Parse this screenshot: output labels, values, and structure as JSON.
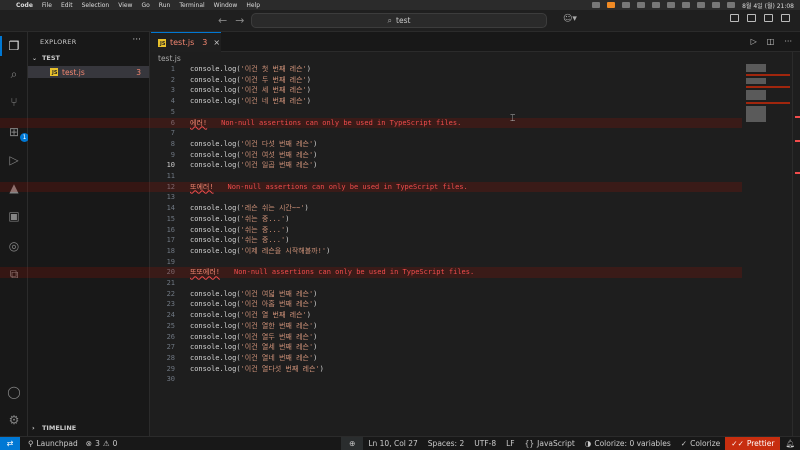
{
  "menubar": {
    "apple": "",
    "items": [
      "Code",
      "File",
      "Edit",
      "Selection",
      "View",
      "Go",
      "Run",
      "Terminal",
      "Window",
      "Help"
    ],
    "clock": "8월 4일 (월) 21:08"
  },
  "titlebar": {
    "search_text": "test"
  },
  "activity": {
    "extensions_badge": "1"
  },
  "sidebar": {
    "header": "EXPLORER",
    "folder": "TEST",
    "file": {
      "name": "test.js",
      "problems": "3"
    },
    "timeline": "TIMELINE"
  },
  "editor": {
    "tab": {
      "name": "test.js",
      "problems": "3"
    },
    "breadcrumb": "test.js",
    "lines": [
      {
        "n": "1",
        "obj": "console.log(",
        "str": "'이건 첫 번째 레슨'",
        "end": ")"
      },
      {
        "n": "2",
        "obj": "console.log(",
        "str": "'이건 두 번째 레슨'",
        "end": ")"
      },
      {
        "n": "3",
        "obj": "console.log(",
        "str": "'이건 세 번째 레슨'",
        "end": ")"
      },
      {
        "n": "4",
        "obj": "console.log(",
        "str": "'이건 네 번째 레슨'",
        "end": ")"
      },
      {
        "n": "5"
      },
      {
        "n": "6",
        "label": "에러!",
        "msg": "Non-null assertions can only be used in TypeScript files."
      },
      {
        "n": "7"
      },
      {
        "n": "8",
        "obj": "console.log(",
        "str": "'이건 다섯 번째 레슨'",
        "end": ")"
      },
      {
        "n": "9",
        "obj": "console.log(",
        "str": "'이건 여섯 번째 레슨'",
        "end": ")"
      },
      {
        "n": "10",
        "obj": "console.log(",
        "str": "'이건 일곱 번째 레슨'",
        "end": ")"
      },
      {
        "n": "11"
      },
      {
        "n": "12",
        "label": "또에러!",
        "msg": "Non-null assertions can only be used in TypeScript files."
      },
      {
        "n": "13"
      },
      {
        "n": "14",
        "obj": "console.log(",
        "str": "'레슨 쉬는 시간~~'",
        "end": ")"
      },
      {
        "n": "15",
        "obj": "console.log(",
        "str": "'쉬는 중...'",
        "end": ")"
      },
      {
        "n": "16",
        "obj": "console.log(",
        "str": "'쉬는 중...'",
        "end": ")"
      },
      {
        "n": "17",
        "obj": "console.log(",
        "str": "'쉬는 중...'",
        "end": ")"
      },
      {
        "n": "18",
        "obj": "console.log(",
        "str": "'이제 레슨을 시작해볼까!'",
        "end": ")"
      },
      {
        "n": "19"
      },
      {
        "n": "20",
        "label": "또또에러!",
        "msg": "Non-null assertions can only be used in TypeScript files."
      },
      {
        "n": "21"
      },
      {
        "n": "22",
        "obj": "console.log(",
        "str": "'이건 여덟 번째 레슨'",
        "end": ")"
      },
      {
        "n": "23",
        "obj": "console.log(",
        "str": "'이건 아홉 번째 레슨'",
        "end": ")"
      },
      {
        "n": "24",
        "obj": "console.log(",
        "str": "'이건 열 번째 레슨'",
        "end": ")"
      },
      {
        "n": "25",
        "obj": "console.log(",
        "str": "'이건 열한 번째 레슨'",
        "end": ")"
      },
      {
        "n": "26",
        "obj": "console.log(",
        "str": "'이건 열두 번째 레슨'",
        "end": ")"
      },
      {
        "n": "27",
        "obj": "console.log(",
        "str": "'이건 열세 번째 레슨'",
        "end": ")"
      },
      {
        "n": "28",
        "obj": "console.log(",
        "str": "'이건 열네 번째 레슨'",
        "end": ")"
      },
      {
        "n": "29",
        "obj": "console.log(",
        "str": "'이건 열다섯 번째 레슨'",
        "end": ")"
      },
      {
        "n": "30"
      }
    ],
    "current_line": "10"
  },
  "statusbar": {
    "launchpad": "Launchpad",
    "errors": "3",
    "warnings": "0",
    "position": "Ln 10, Col 27",
    "spaces": "Spaces: 2",
    "encoding": "UTF-8",
    "eol": "LF",
    "language": "JavaScript",
    "colorize_vars": "Colorize: 0 variables",
    "colorize": "Colorize",
    "prettier": "Prettier"
  }
}
